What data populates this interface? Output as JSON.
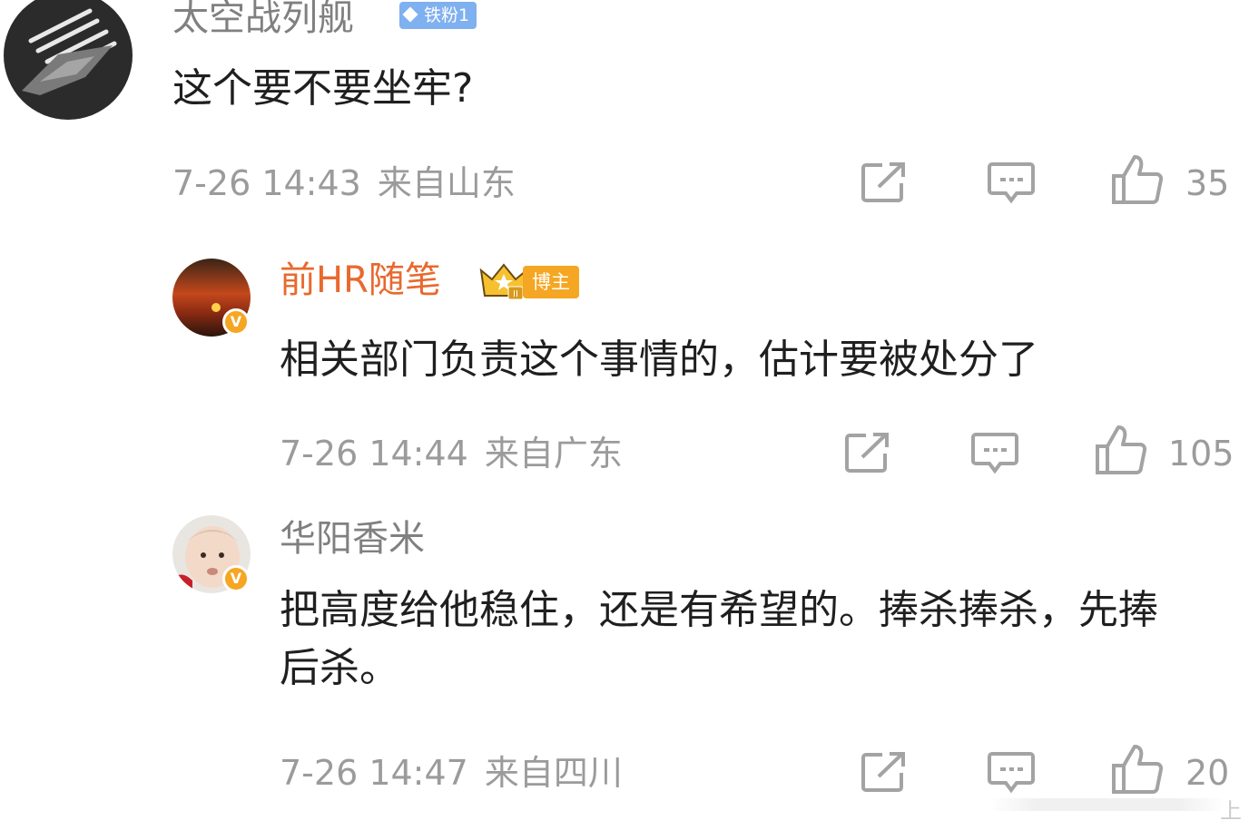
{
  "comments": [
    {
      "username": "太空战列舰",
      "fan_badge": "铁粉1",
      "text": "这个要不要坐牢?",
      "time": "7-26 14:43",
      "location": "来自山东",
      "likes": "35"
    },
    {
      "username": "前HR随笔",
      "crown_level": "II",
      "blogger_badge": "博主",
      "verified_mark": "V",
      "text": "相关部门负责这个事情的，估计要被处分了",
      "time": "7-26 14:44",
      "location": "来自广东",
      "likes": "105"
    },
    {
      "username": "华阳香米",
      "verified_mark": "V",
      "text": "把高度给他稳住，还是有希望的。捧杀捧杀，先捧后杀。",
      "time": "7-26 14:47",
      "location": "来自四川",
      "likes": "20"
    }
  ],
  "icons": {
    "share": "share-icon",
    "reply": "comment-icon",
    "like": "thumbs-up-icon"
  },
  "colors": {
    "vip_name": "#e8692e",
    "verified_badge": "#f5a623",
    "fan_badge": "#7fb0f0",
    "meta_text": "#9b9b9b"
  },
  "watermark": "上"
}
